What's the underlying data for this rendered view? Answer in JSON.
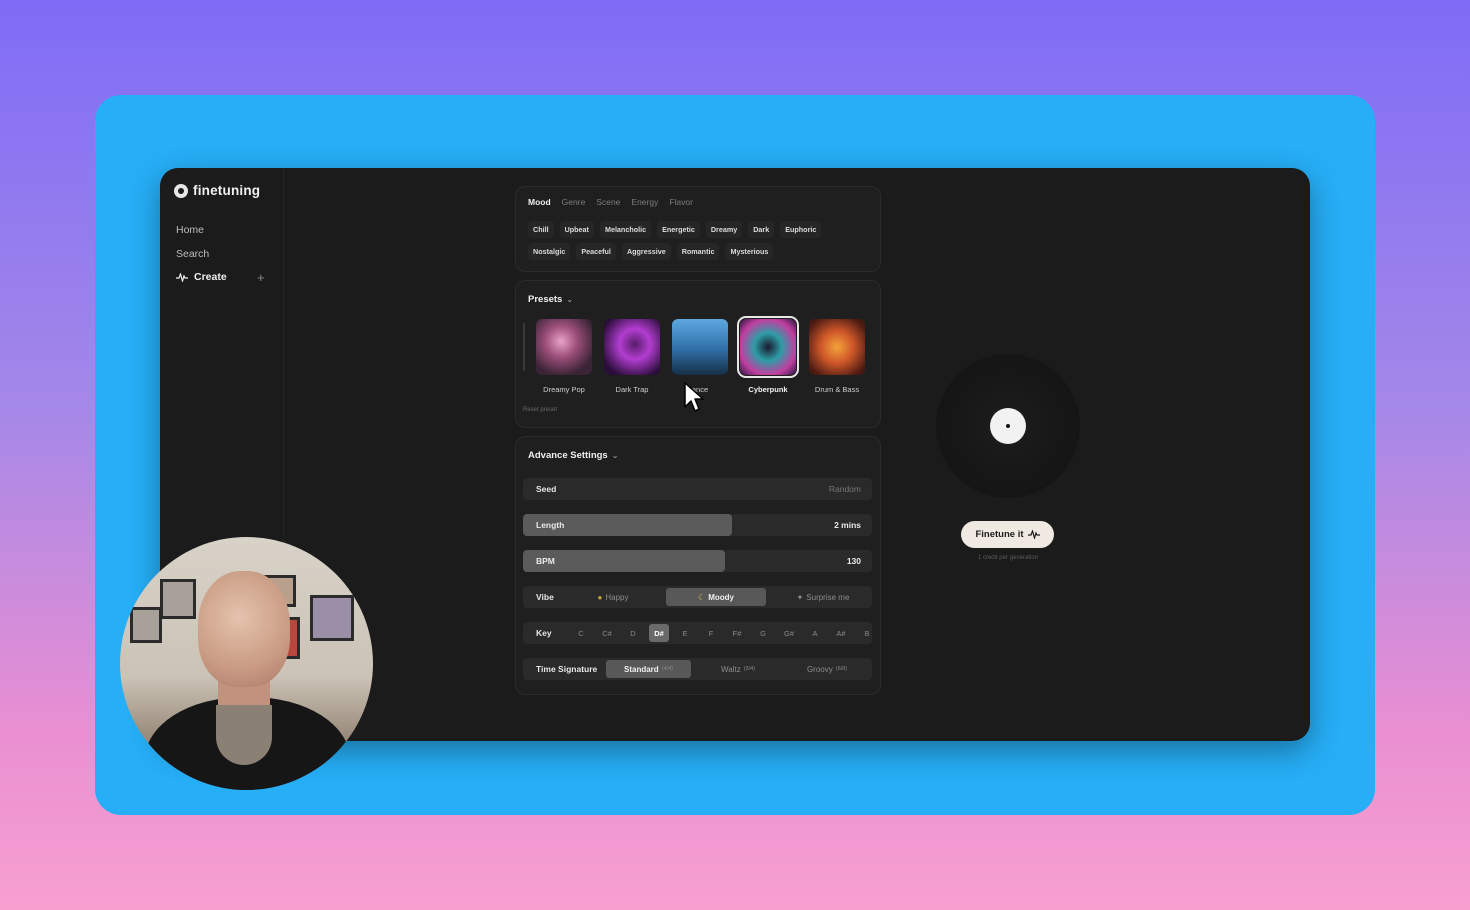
{
  "app": {
    "name": "finetuning",
    "nav": {
      "home": "Home",
      "search": "Search",
      "create": "Create"
    }
  },
  "tabs": [
    "Mood",
    "Genre",
    "Scene",
    "Energy",
    "Flavor"
  ],
  "mood_chips_row1": [
    "Chill",
    "Upbeat",
    "Melancholic",
    "Energetic",
    "Dreamy",
    "Dark",
    "Euphoric"
  ],
  "mood_chips_row2": [
    "Nostalgic",
    "Peaceful",
    "Aggressive",
    "Romantic",
    "Mysterious"
  ],
  "presets": {
    "title": "Presets",
    "items": [
      {
        "label": "Dreamy Pop"
      },
      {
        "label": "Dark Trap"
      },
      {
        "label": "ance"
      },
      {
        "label": "Cyberpunk",
        "selected": true
      },
      {
        "label": "Drum & Bass"
      }
    ],
    "reset_label": "Reset preset"
  },
  "advanced": {
    "title": "Advance Settings",
    "seed": {
      "label": "Seed",
      "value": "Random"
    },
    "length": {
      "label": "Length",
      "value": "2 mins",
      "fill_fraction": 0.6
    },
    "bpm": {
      "label": "BPM",
      "value": "130",
      "fill_fraction": 0.58
    },
    "vibe": {
      "label": "Vibe",
      "options": [
        "Happy",
        "Moody",
        "Surprise me"
      ],
      "selected": "Moody"
    },
    "key": {
      "label": "Key",
      "options": [
        "C",
        "C#",
        "D",
        "D#",
        "E",
        "F",
        "F#",
        "G",
        "G#",
        "A",
        "A#",
        "B"
      ],
      "selected": "D#"
    },
    "time_signature": {
      "label": "Time Signature",
      "options": [
        {
          "name": "Standard",
          "sig": "(4/4)"
        },
        {
          "name": "Waltz",
          "sig": "(3/4)"
        },
        {
          "name": "Groovy",
          "sig": "(6/8)"
        }
      ],
      "selected": "Standard"
    }
  },
  "player": {
    "button_label": "Finetune it",
    "credit_note": "1 credit per generation"
  },
  "colors": {
    "frame": "#26aef6",
    "app_bg": "#1b1b1b",
    "button_bg": "#efe9e2"
  }
}
